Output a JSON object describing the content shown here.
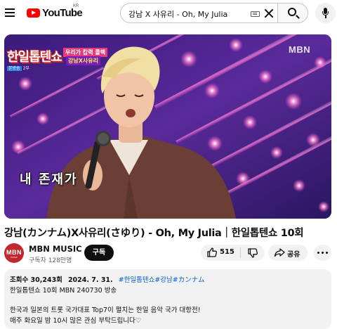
{
  "header": {
    "logo_text": "YouTube",
    "country_code": "KR",
    "search_query": "강남 X 사유리 - Oh, My Julia"
  },
  "player": {
    "show_logo": "한일톱텐쇼",
    "show_sub_tag": "본방송",
    "show_sub_text": "2부",
    "badge_top": "우리가 캅력 콜랙",
    "badge_bottom": "강남X사유리",
    "channel_bug": "MBN",
    "caption": "내 존재가"
  },
  "video": {
    "title": "강남(カンナム)X사유리(さゆり) - Oh, My Julia｜한일톱텐쇼 10회"
  },
  "channel": {
    "avatar_text": "MBN",
    "avatar_subtext": "MUSIC",
    "name": "MBN MUSIC",
    "subscribers": "구독자 128만명",
    "subscribe_label": "구독"
  },
  "actions": {
    "like_count": "515",
    "share_label": "공유"
  },
  "description": {
    "views": "조회수 30,243회",
    "date": "2024. 7. 31.",
    "hashtags": [
      "#한일톱텐쇼",
      "#강남",
      "#カンナム"
    ],
    "line1": "한일톱텐쇼 10회 MBN 240730 방송",
    "line2": "한국과 일본의 트롯 국가대표 Top7이 펼치는 한일 음악 국가 대항전!",
    "line3": "매주 화요일 밤 10시 많은 관심 부탁드립니다♡"
  },
  "colors": {
    "brand_red": "#ff0000",
    "link_blue": "#065fd4",
    "chip_gray": "#f2f2f2",
    "avatar_red": "#c1272d"
  }
}
